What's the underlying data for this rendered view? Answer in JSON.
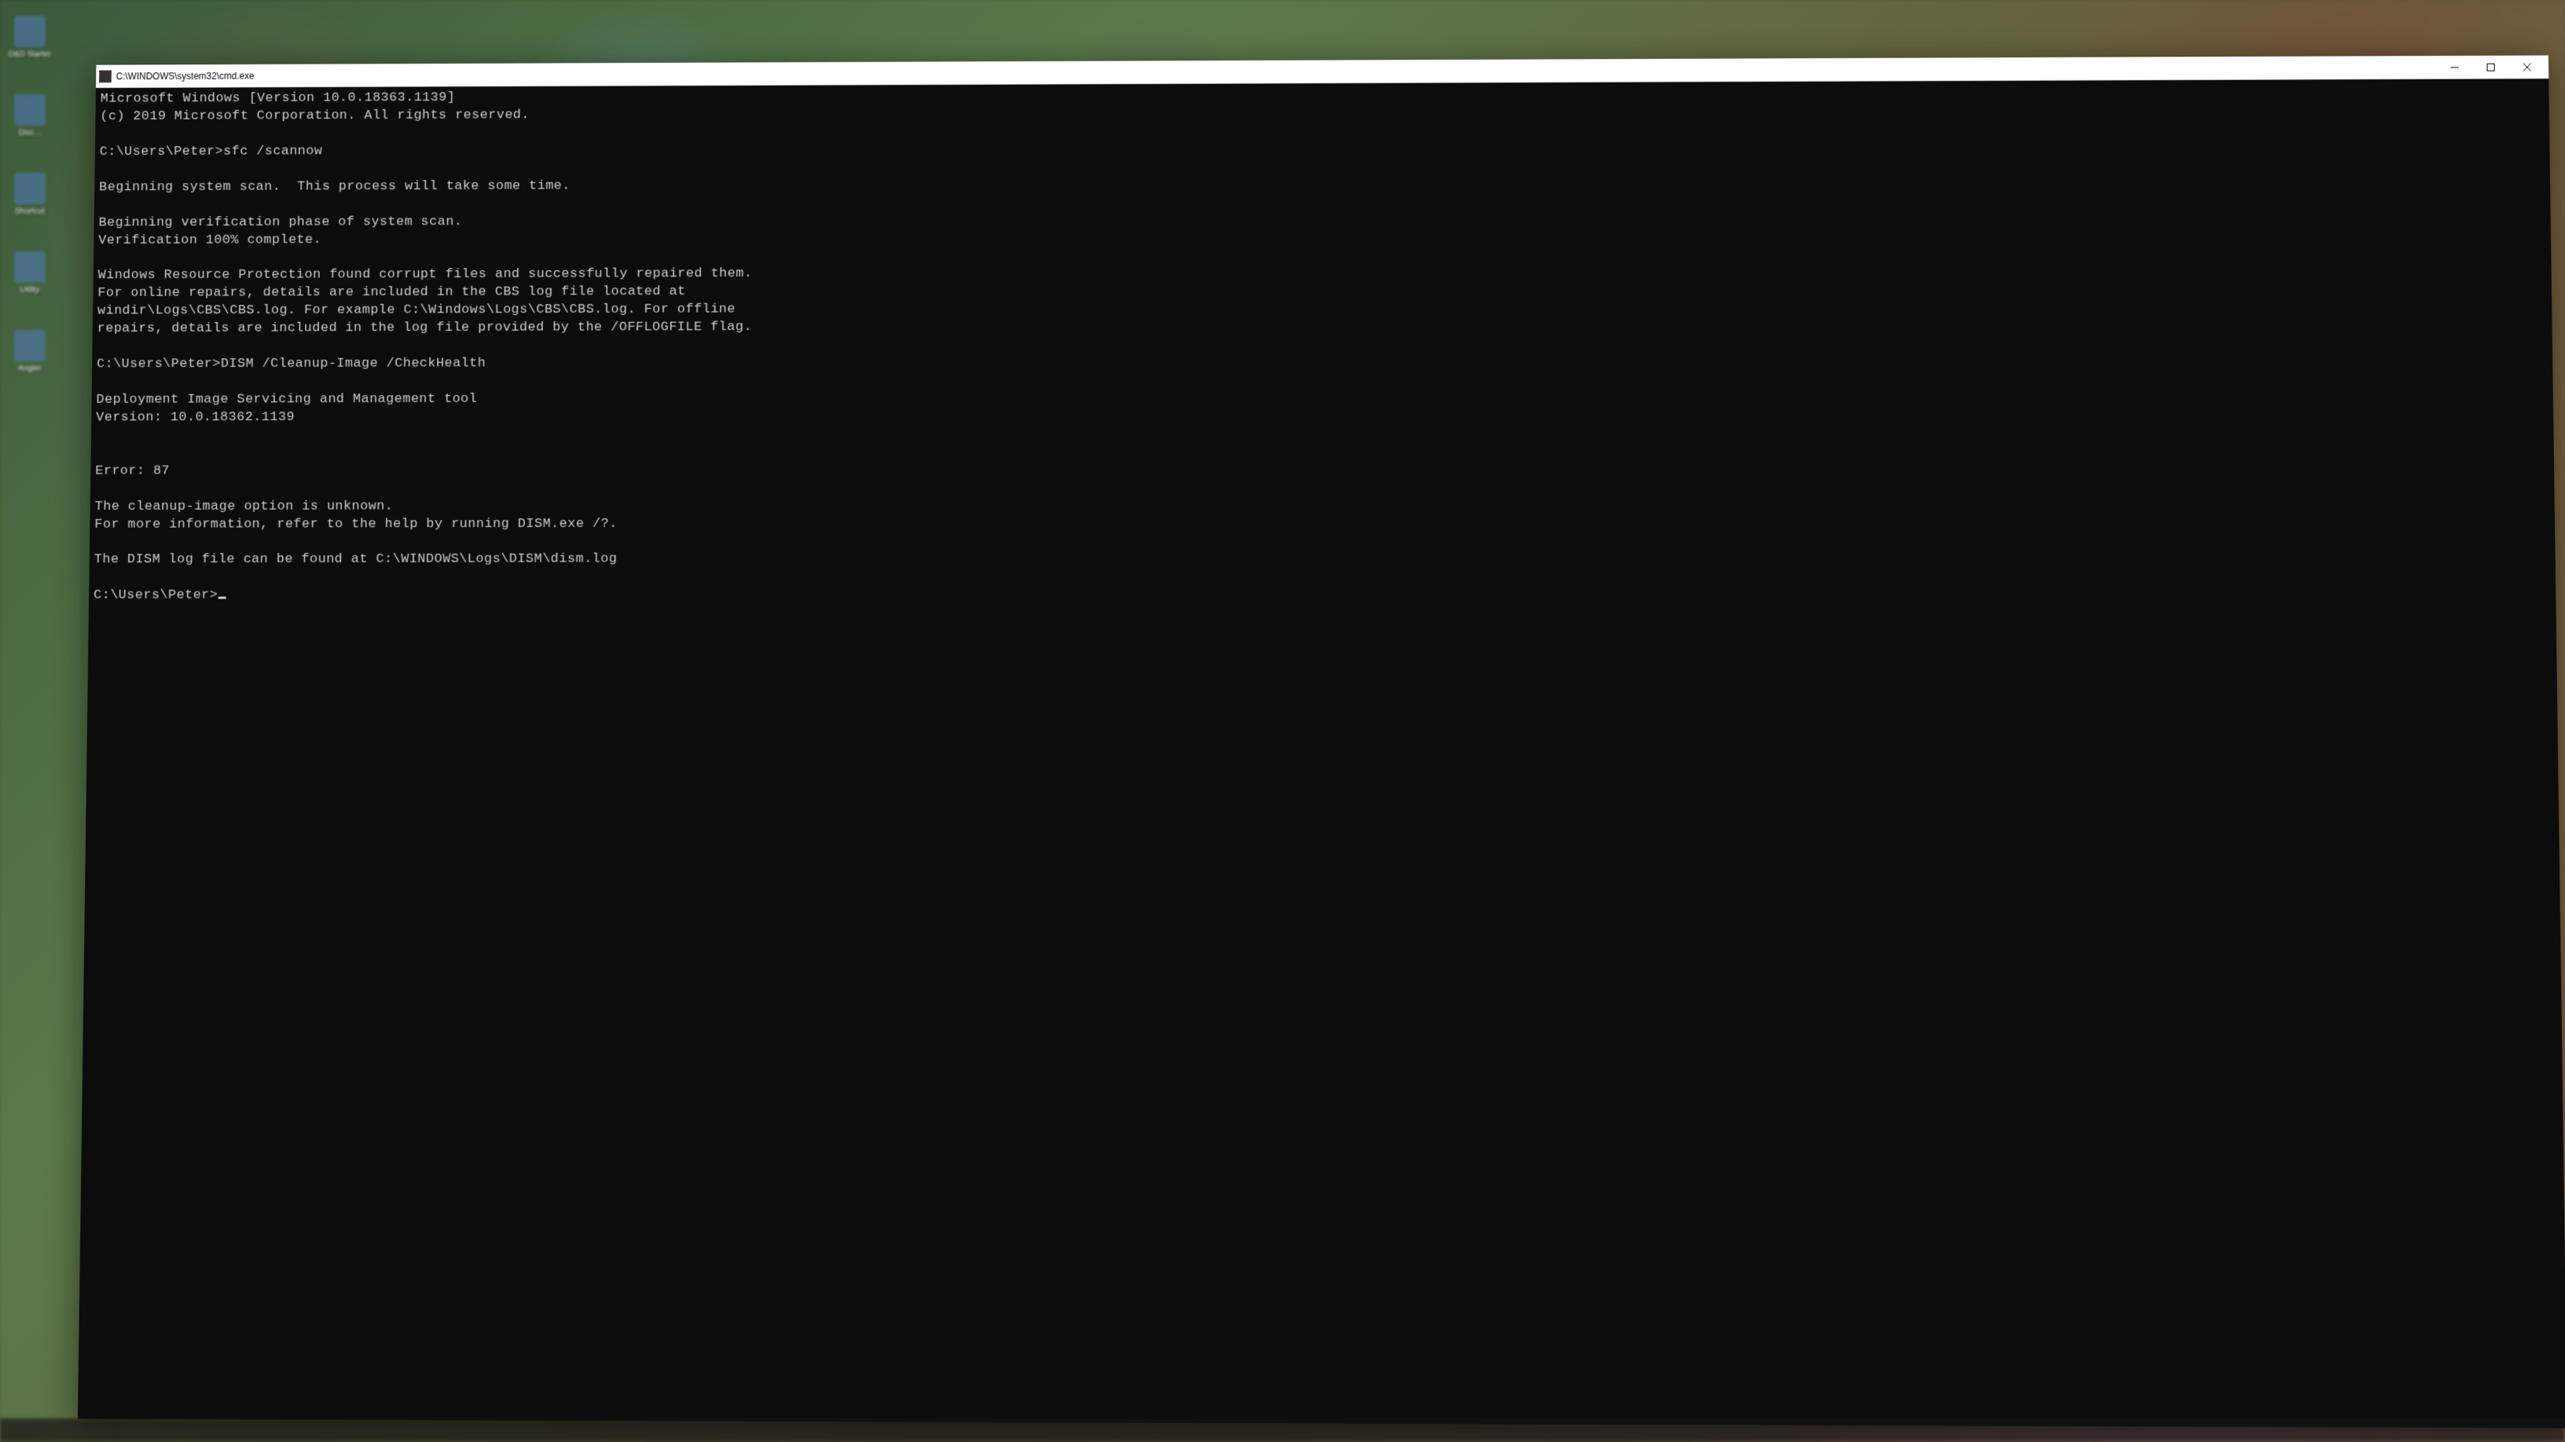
{
  "window": {
    "title": "C:\\WINDOWS\\system32\\cmd.exe",
    "icon_name": "cmd-icon"
  },
  "desktop": {
    "icons": [
      {
        "label": "D&D Starter"
      },
      {
        "label": "Disc..."
      },
      {
        "label": "Shortcut"
      },
      {
        "label": "Utility"
      },
      {
        "label": "Angler"
      }
    ]
  },
  "terminal": {
    "lines": [
      "Microsoft Windows [Version 10.0.18363.1139]",
      "(c) 2019 Microsoft Corporation. All rights reserved.",
      "",
      "C:\\Users\\Peter>sfc /scannow",
      "",
      "Beginning system scan.  This process will take some time.",
      "",
      "Beginning verification phase of system scan.",
      "Verification 100% complete.",
      "",
      "Windows Resource Protection found corrupt files and successfully repaired them.",
      "For online repairs, details are included in the CBS log file located at",
      "windir\\Logs\\CBS\\CBS.log. For example C:\\Windows\\Logs\\CBS\\CBS.log. For offline",
      "repairs, details are included in the log file provided by the /OFFLOGFILE flag.",
      "",
      "C:\\Users\\Peter>DISM /Cleanup-Image /CheckHealth",
      "",
      "Deployment Image Servicing and Management tool",
      "Version: 10.0.18362.1139",
      "",
      "",
      "Error: 87",
      "",
      "The cleanup-image option is unknown.",
      "For more information, refer to the help by running DISM.exe /?.",
      "",
      "The DISM log file can be found at C:\\WINDOWS\\Logs\\DISM\\dism.log",
      "",
      "C:\\Users\\Peter>"
    ],
    "prompt_index_with_cursor": 28
  }
}
